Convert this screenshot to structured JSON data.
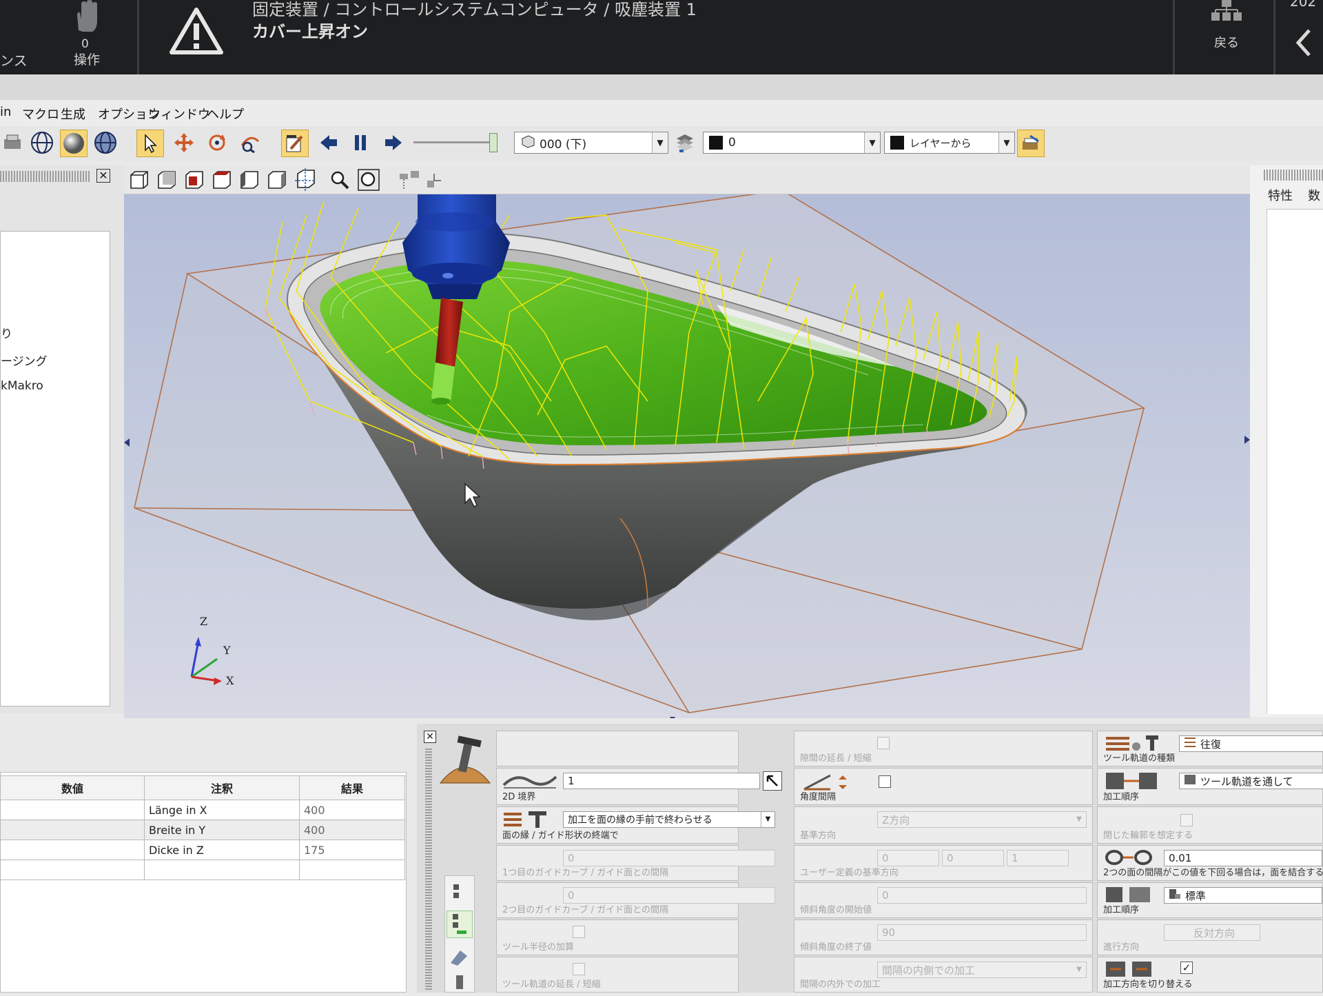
{
  "status": {
    "left_cut_label": "ンス",
    "operation_count": "0",
    "operation_label": "操作",
    "path": "固定装置 / コントロールシステムコンピュータ / 吸塵装置 1",
    "message": "カバー上昇オン",
    "back_label": "戻る",
    "clock_cut": "202"
  },
  "menu": [
    "in",
    "マクロ",
    "生成",
    "オプション",
    "ウィンドウ",
    "ヘルプ"
  ],
  "toolbar": {
    "view_combo": "000 (下)",
    "color_combo": "0",
    "layer_combo": "レイヤーから"
  },
  "left_tree": [
    "り",
    "ージング",
    "kMakro"
  ],
  "right_panel": {
    "tab1": "特性",
    "tab2": "数"
  },
  "axes": {
    "z": "Z",
    "y": "Y",
    "x": "X"
  },
  "params_table": {
    "headers": [
      "数値",
      "注釈",
      "結果"
    ],
    "rows": [
      [
        "",
        "Länge in X",
        "400"
      ],
      [
        "",
        "Breite in Y",
        "400"
      ],
      [
        "",
        "Dicke in Z",
        "175"
      ],
      [
        "",
        "",
        ""
      ]
    ]
  },
  "toolpath": {
    "boundary_value": "1",
    "boundary_label": "2D 境界",
    "edge_extension_label": "隙間の延長 / 短縮",
    "angle_label": "角度間隔",
    "edge_combo": "加工を面の縁の手前で終わらせる",
    "edge_label": "面の縁 / ガイド形状の終端で",
    "reference_combo": "Z方向",
    "reference_label": "基準方向",
    "guide1_value": "0",
    "guide1_label": "1つ目のガイドカーブ / ガイド面との間隔",
    "user_values": [
      "0",
      "0",
      "1"
    ],
    "user_label": "ユーザー定義の基準方向",
    "guide2_value": "0",
    "guide2_label": "2つ目のガイドカーブ / ガイド面との間隔",
    "tilt_start_value": "0",
    "tilt_start_label": "傾斜角度の開始値",
    "tool_radius_label": "ツール半径の加算",
    "tilt_end_value": "90",
    "tilt_end_label": "傾斜角度の終了値",
    "tool_ext_label": "ツール軌道の延長 / 短縮",
    "inner_combo": "間隔の内側での加工",
    "inner_label": "間隔の内外での加工",
    "track_type_value": "往復",
    "track_type_label": "ツール軌道の種類",
    "order_value": "ツール軌道を通して",
    "order_label": "加工順序",
    "closed_label": "閉じた輪郭を想定する",
    "merge_value": "0.01",
    "merge_label": "2つの面の間隔がこの値を下回る場合は，面を結合する",
    "order2_value": "標準",
    "order2_label": "加工順序",
    "direction_value": "反対方向",
    "direction_label": "進行方向",
    "switch_label": "加工方向を切り替える"
  },
  "colors": {
    "status_bg": "#1e1f21",
    "viewport_top": "#b4bdd8",
    "part_green": "#4fb11a",
    "toolpath_yellow": "#f2e600",
    "spindle_blue": "#1d3fb0",
    "tool_red": "#b01e16"
  }
}
